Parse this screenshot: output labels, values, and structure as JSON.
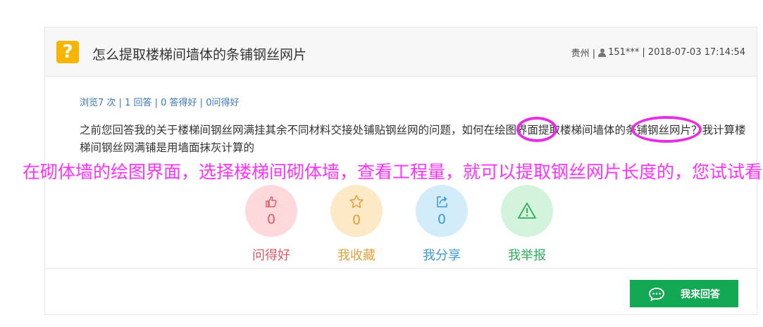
{
  "question": {
    "icon": "question-mark-icon",
    "icon_glyph": "?",
    "title": "怎么提取楼梯间墙体的条铺钢丝网片",
    "location": "贵州 |",
    "user": "151***",
    "datetime": "| 2018-07-03 17:14:54"
  },
  "stats": {
    "views": "浏览7 次",
    "answers": "1 回答",
    "good_answers": "0 答得好",
    "good_questions": "0问得好",
    "separator": " | "
  },
  "body_text": "之前您回答我的关于楼梯间钢丝网满挂其余不同材料交接处铺贴钢丝网的问题，如何在绘图界面提取楼梯间墙体的条铺钢丝网片？我计算楼梯间钢丝网满铺是用墙面抹灰计算的",
  "annotation": "在砌体墙的绘图界面，选择楼梯间砌体墙，查看工程量，就可以提取钢丝网片长度的，您试试看",
  "actions": [
    {
      "id": "good-question",
      "label": "问得好",
      "count": "0",
      "icon": "thumbs-up-icon",
      "bg": "#ffd9dc",
      "color": "#e05a66"
    },
    {
      "id": "collect",
      "label": "我收藏",
      "count": "0",
      "icon": "star-icon",
      "bg": "#fde9c5",
      "color": "#e2a13a"
    },
    {
      "id": "share",
      "label": "我分享",
      "count": "0",
      "icon": "share-icon",
      "bg": "#d3ecfa",
      "color": "#3a9ad9"
    },
    {
      "id": "report",
      "label": "我举报",
      "count": "",
      "icon": "warning-icon",
      "bg": "#d4f3dd",
      "color": "#2fae5b"
    }
  ],
  "answer_button": "我来回答",
  "colors": {
    "accent_green": "#13a853",
    "link_blue": "#3a78c3",
    "annotation_magenta": "#ff33ff",
    "question_icon_yellow": "#f7b500"
  }
}
